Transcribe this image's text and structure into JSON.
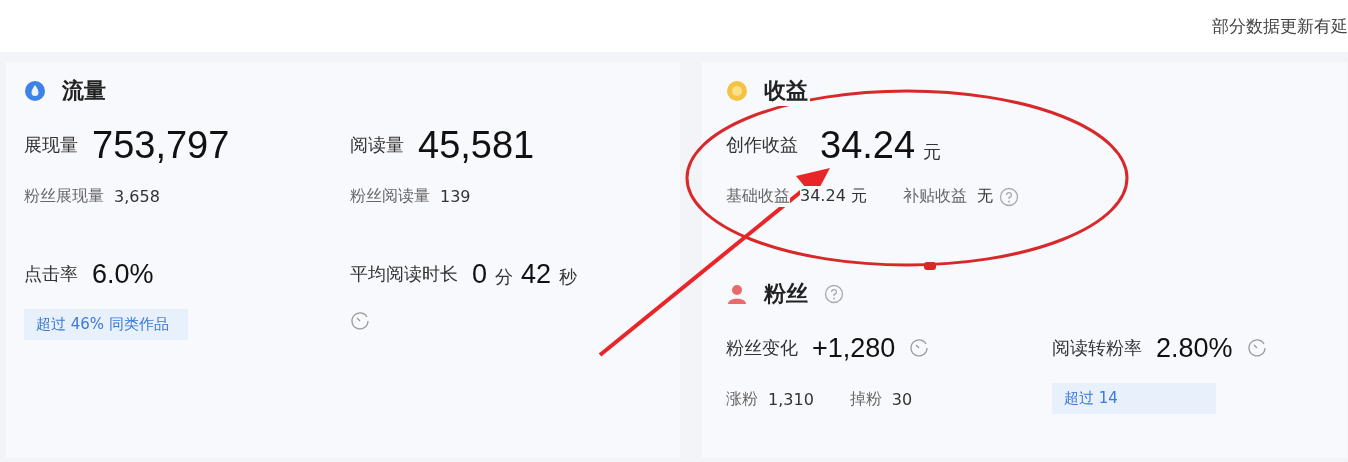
{
  "notice": "部分数据更新有延",
  "panels": [
    {
      "sections": [
        {
          "title": "流量",
          "help": false,
          "metrics": [
            {
              "kind": "headline",
              "label": "展现量",
              "value": [
                {
                  "kind": "number",
                  "text": "753,797"
                }
              ],
              "subs": [
                {
                  "label": "粉丝展现量",
                  "value": "3,658"
                }
              ]
            },
            {
              "kind": "headline",
              "label": "阅读量",
              "value": [
                {
                  "kind": "number",
                  "text": "45,581"
                }
              ],
              "subs": [
                {
                  "label": "粉丝阅读量",
                  "value": "139"
                }
              ]
            },
            {
              "kind": "stat",
              "label": "点击率",
              "value": [
                {
                  "kind": "number",
                  "text": "6.0%"
                }
              ],
              "badge": "超过 46% 同类作品"
            },
            {
              "kind": "duration",
              "label": "平均阅读时长",
              "value": [
                {
                  "kind": "number",
                  "text": "0"
                },
                {
                  "kind": "unit",
                  "text": "分"
                },
                {
                  "kind": "number",
                  "text": "42"
                },
                {
                  "kind": "unit",
                  "text": "秒"
                }
              ]
            }
          ]
        }
      ]
    },
    {
      "sections": [
        {
          "title": "收益",
          "help": false,
          "metrics": [
            {
              "kind": "total",
              "label": "创作收益",
              "value": [
                {
                  "kind": "number",
                  "text": "34.24"
                },
                {
                  "kind": "unit",
                  "text": "元"
                }
              ],
              "subs": [
                {
                  "label": "基础收益",
                  "value": "34.24 元"
                },
                {
                  "label": "补贴收益",
                  "value": "无",
                  "help": true
                }
              ]
            }
          ]
        },
        {
          "title": "粉丝",
          "help": true,
          "metrics": [
            {
              "kind": "timed",
              "label": "粉丝变化",
              "value": [
                {
                  "kind": "number",
                  "text": "+1,280"
                }
              ],
              "subs": [
                {
                  "label": "涨粉",
                  "value": "1,310"
                },
                {
                  "label": "掉粉",
                  "value": "30"
                }
              ]
            },
            {
              "kind": "timed",
              "label": "阅读转粉率",
              "value": [
                {
                  "kind": "number",
                  "text": "2.80%"
                }
              ],
              "badge": "超过 14"
            }
          ]
        }
      ]
    }
  ],
  "annotations": [
    {
      "kind": "ellipse"
    },
    {
      "kind": "arrow"
    }
  ]
}
